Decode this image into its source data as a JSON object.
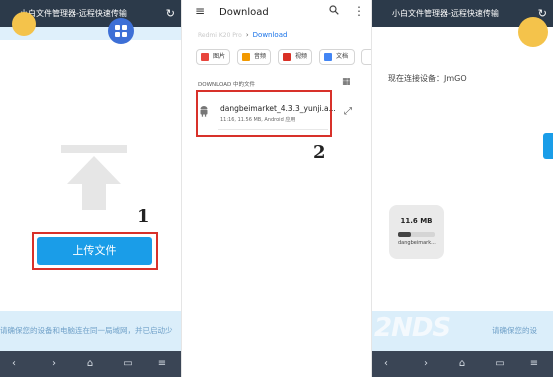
{
  "panel1": {
    "title": "小白文件管理器-远程快速传输",
    "refresh_icon": "↻",
    "upload_button": "上传文件",
    "step": "1",
    "banner": "请确保您的设备和电脑连在同一局域网，并已启动少"
  },
  "panel2": {
    "title": "Download",
    "breadcrumb": {
      "device": "Redmi K20 Pro",
      "current": "Download"
    },
    "chips": [
      {
        "label": "图片",
        "color": "#e8453c"
      },
      {
        "label": "音频",
        "color": "#f29900"
      },
      {
        "label": "视频",
        "color": "#d93025"
      },
      {
        "label": "文档",
        "color": "#4285f4"
      }
    ],
    "section_label": "DOWNLOAD 中的文件",
    "file": {
      "name": "dangbeimarket_4.3.3_yunji.a...",
      "meta": "11:16, 11.56 MB, Android 应用"
    },
    "step": "2"
  },
  "panel3": {
    "title": "小白文件管理器-远程快速传输",
    "refresh_icon": "↻",
    "connected": "现在连接设备：JmGO",
    "file_card": {
      "size": "11.6 MB",
      "name": "dangbeimark...",
      "progress": 0.35
    },
    "banner": "请确保您的设",
    "watermark": "2NDS"
  },
  "nav_icons": [
    "‹",
    "›",
    "⌂",
    "▭",
    "≡"
  ]
}
